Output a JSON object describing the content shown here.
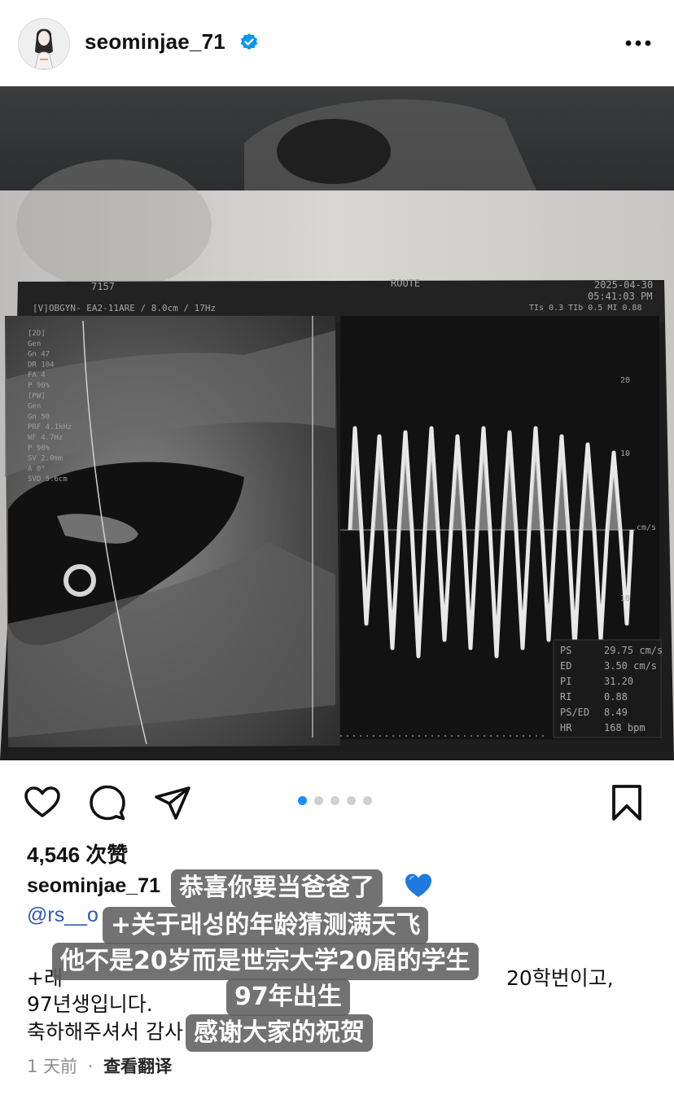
{
  "header": {
    "username": "seominjae_71",
    "verified_icon": "verified-badge-icon",
    "more_icon": "more-options-icon",
    "avatar_icon": "profile-avatar"
  },
  "photo": {
    "description_icon": "ultrasound-printout-image",
    "top_right_date": "2025-04-30",
    "top_right_time": "05:41:03 PM",
    "top_center": "ROUTE",
    "top_left_code": "7157",
    "mode_line": "[V]OBGYN-  EA2-11ARE / 8.0cm / 17Hz",
    "tis_line": "TIs  0.3   TIb  0.5   MI  0.88",
    "left_params": [
      "[2D]",
      "Gen",
      "Gn 47",
      "DR 104",
      "FA 4",
      "P 90%",
      "[PW]",
      "Gen",
      "Gn 50",
      "PRF 4.1kHz",
      "WF 4.7Hz",
      "P 90%",
      "SV 2.0mm",
      "A 0°",
      "SVD 5.6cm"
    ],
    "scale_labels": [
      "20",
      "10",
      "cm/s",
      "10"
    ],
    "measurements": [
      {
        "label": "PS",
        "value": "29.75 cm/s"
      },
      {
        "label": "ED",
        "value": "3.50 cm/s"
      },
      {
        "label": "PI",
        "value": "31.20"
      },
      {
        "label": "RI",
        "value": "0.88"
      },
      {
        "label": "PS/ED",
        "value": "8.49"
      },
      {
        "label": "HR",
        "value": "168 bpm"
      }
    ],
    "carousel_total": 5,
    "carousel_active": 1
  },
  "actions": {
    "like_icon": "heart-outline-icon",
    "comment_icon": "comment-bubble-icon",
    "share_icon": "paper-plane-icon",
    "save_icon": "bookmark-outline-icon"
  },
  "post": {
    "likes": "4,546 次赞",
    "caption_username": "seominjae_71",
    "mention": "@rs__o",
    "line1_start": "+래",
    "line1_end": "20학번이고,",
    "line2": "97년생입니다.",
    "line3": "축하해주셔서 감사",
    "time_ago": "1 天前",
    "separator": "·",
    "translate": "查看翻译"
  },
  "subtitles": {
    "s1": "恭喜你要当爸爸了",
    "s2": "+关于래성的年龄猜测满天飞",
    "s3": "他不是20岁而是世宗大学20届的学生",
    "s4": "97年出生",
    "s5": "感谢大家的祝贺",
    "heart_emoji_icon": "blue-heart-emoji-icon"
  },
  "colors": {
    "accent_blue": "#1a8cff",
    "verified_blue": "#0095f6",
    "mention_blue": "#2d57b8",
    "subtitle_bg": "#5f5f5f",
    "heart_emoji": "#1f7ae0"
  }
}
